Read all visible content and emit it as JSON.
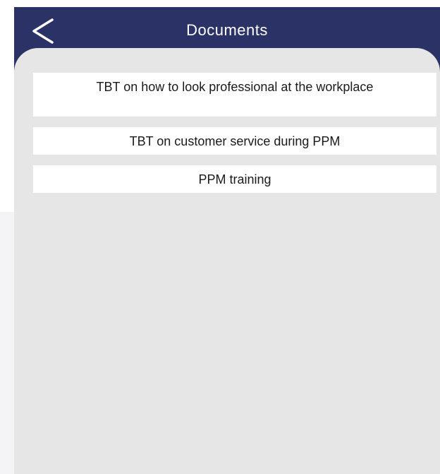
{
  "header": {
    "title": "Documents",
    "back_icon": "chevron-left-icon"
  },
  "documents": [
    {
      "label": "TBT on how to look professional at the workplace"
    },
    {
      "label": "TBT on customer service during PPM"
    },
    {
      "label": "PPM training"
    }
  ],
  "colors": {
    "header_bg": "#2a3266",
    "content_bg": "#e6e6e6",
    "item_bg": "#ffffff",
    "title_text": "#ffffff"
  }
}
